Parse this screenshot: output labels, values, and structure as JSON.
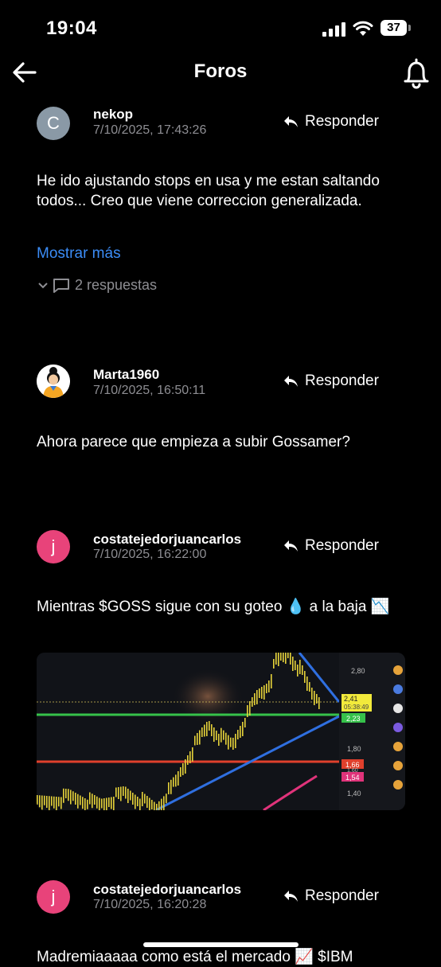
{
  "status": {
    "time": "19:04",
    "battery": "37"
  },
  "header": {
    "title": "Foros"
  },
  "posts": [
    {
      "avatar_letter": "C",
      "avatar_color": "#8a99a6",
      "username": "nekop",
      "date": "7/10/2025, 17:43:26",
      "reply_label": "Responder",
      "text": "He ido ajustando stops en usa y me estan saltando todos... Creo que viene correccion generalizada.",
      "show_more": "Mostrar más",
      "responses": "2 respuestas"
    },
    {
      "avatar_letter": "",
      "username": "Marta1960",
      "date": "7/10/2025, 16:50:11",
      "reply_label": "Responder",
      "text": "Ahora parece que empieza a subir Gossamer?"
    },
    {
      "avatar_letter": "j",
      "avatar_color": "#e8437a",
      "username": "costatejedorjuancarlos",
      "date": "7/10/2025, 16:22:00",
      "reply_label": "Responder",
      "text": "Mientras $GOSS sigue con su goteo 💧 a la baja 📉",
      "chart_labels": [
        "2,80",
        "2,41",
        "05:38:49",
        "2,23",
        "1,80",
        "1,66",
        "1,60",
        "1,54",
        "1,40"
      ]
    },
    {
      "avatar_letter": "j",
      "avatar_color": "#e8437a",
      "username": "costatejedorjuancarlos",
      "date": "7/10/2025, 16:20:28",
      "reply_label": "Responder",
      "text": "Madremiaaaaa como está el mercado 📈 $IBM"
    }
  ]
}
